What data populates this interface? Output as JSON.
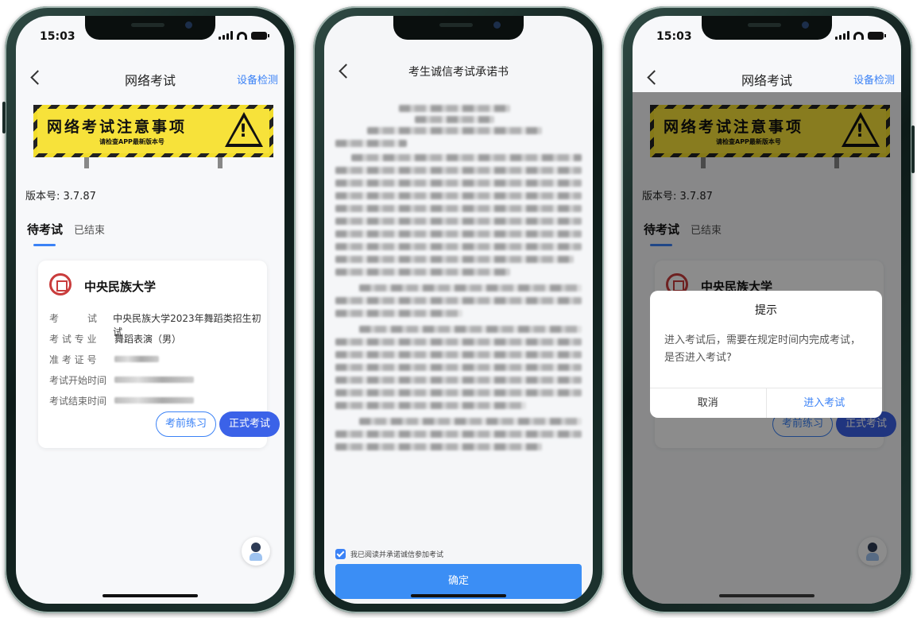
{
  "colors": {
    "accent": "#3b82f6",
    "exam_button": "#3b62e8",
    "banner_yellow": "#f7e23a"
  },
  "status": {
    "time": "15:03"
  },
  "exam_screen": {
    "nav_title": "网络考试",
    "nav_right": "设备检测",
    "banner_title": "网络考试注意事项",
    "banner_subtitle": "请检查APP最新版本号",
    "version": "版本号: 3.7.87",
    "tabs": [
      "待考试",
      "已结束"
    ],
    "card": {
      "school": "中央民族大学",
      "rows": [
        {
          "key": "考　　　试",
          "value": "中央民族大学2023年舞蹈类招生初试"
        },
        {
          "key": "考 试 专 业",
          "value": "舞蹈表演（男）"
        },
        {
          "key": "准 考 证 号",
          "value": ""
        },
        {
          "key": "考试开始时间",
          "value": ""
        },
        {
          "key": "考试结束时间",
          "value": ""
        }
      ],
      "practice_button": "考前练习",
      "exam_button": "正式考试"
    }
  },
  "pledge_screen": {
    "nav_title": "考生诚信考试承诺书",
    "agree_text": "我已阅读并承诺诚信参加考试",
    "confirm_button": "确定"
  },
  "dialog": {
    "title": "提示",
    "message": "进入考试后，需要在规定时间内完成考试，是否进入考试?",
    "cancel": "取消",
    "enter": "进入考试"
  }
}
